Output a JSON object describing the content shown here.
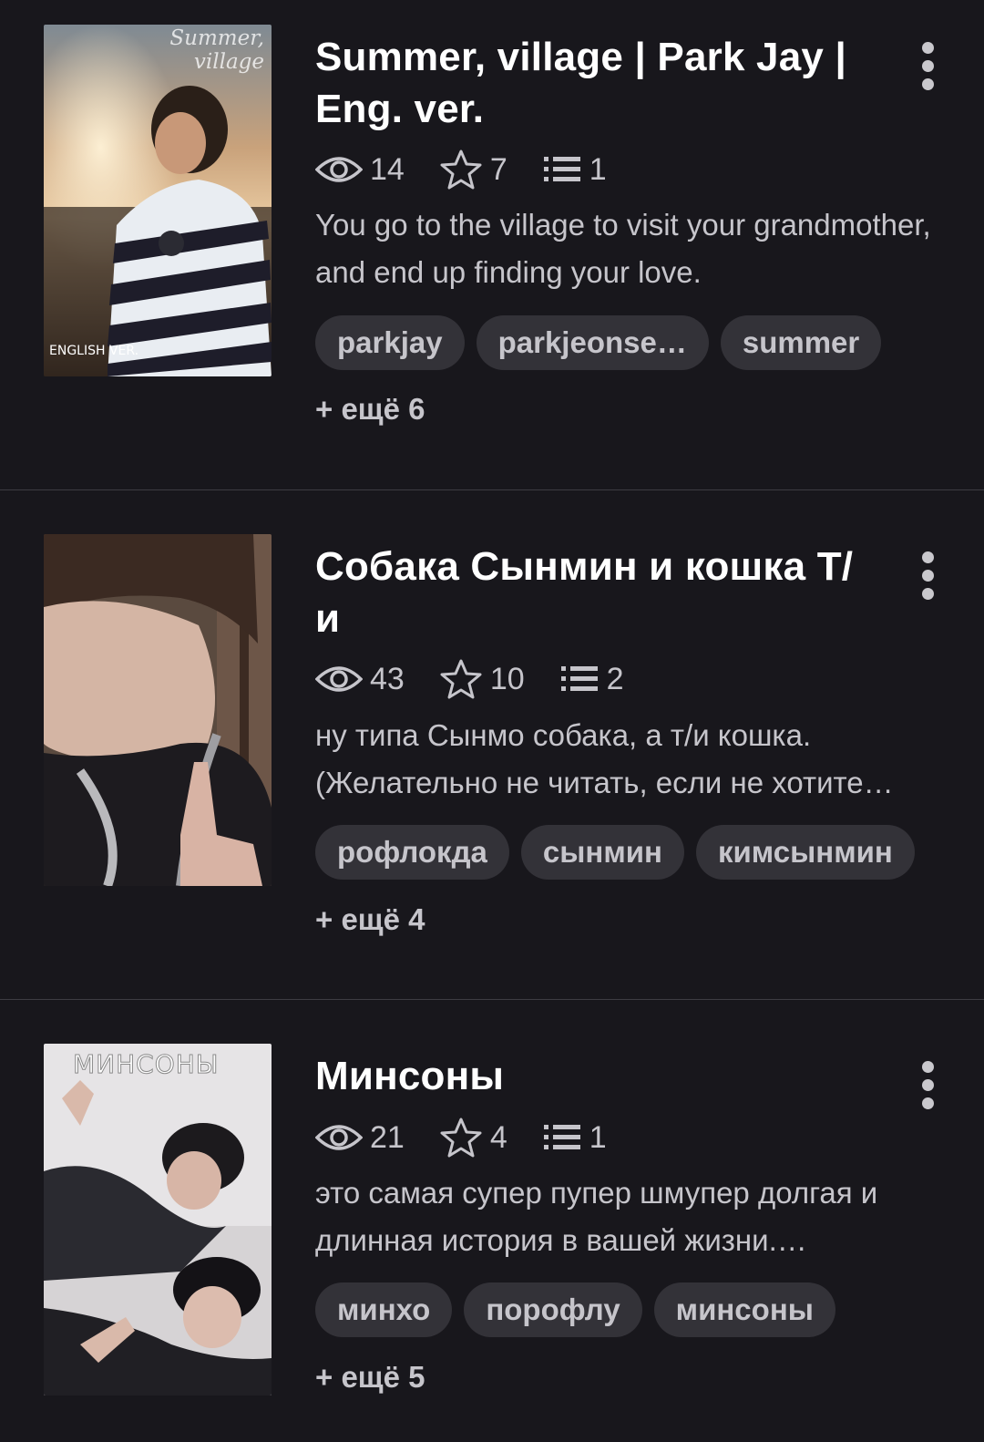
{
  "stories": [
    {
      "title": "Summer, village | Park Jay | Eng. ver.",
      "cover_text_top": "Summer, village",
      "cover_text_bottom": "ENGLISH VER.",
      "views": "14",
      "stars": "7",
      "parts": "1",
      "description": "You go to the village to visit your grandmother, and end up finding your love.",
      "tags": [
        "parkjay",
        "parkjeonse…",
        "summer"
      ],
      "more": "+ ещё 6"
    },
    {
      "title": "Собака Сынмин и кошка Т/и",
      "views": "43",
      "stars": "10",
      "parts": "2",
      "description": "ну типа Сынмо собака, а т/и кошка. (Желательно не читать, если не хотите…",
      "tags": [
        "рофлокда",
        "сынмин",
        "кимсынмин"
      ],
      "more": "+ ещё 4"
    },
    {
      "title": "Минсоны",
      "cover_text_top": "МИНСОНЫ",
      "views": "21",
      "stars": "4",
      "parts": "1",
      "description": "это самая супер пупер шмупер долгая и длинная история в вашей жизни.…",
      "tags": [
        "минхо",
        "порофлу",
        "минсоны"
      ],
      "more": "+ ещё 5"
    }
  ],
  "icons": {
    "views": "eye-icon",
    "stars": "star-icon",
    "parts": "list-icon",
    "menu": "more-vertical-icon"
  }
}
